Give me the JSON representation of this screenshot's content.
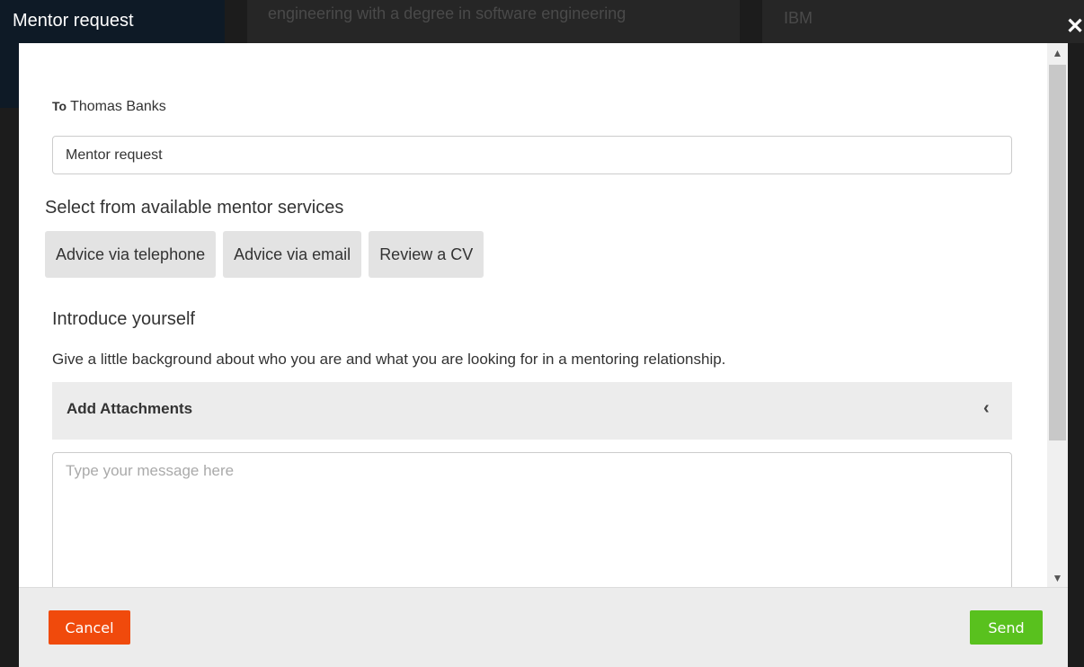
{
  "background": {
    "text_1": "engineering with a degree in software engineering",
    "text_2": "IBM"
  },
  "modal": {
    "title": "Mentor request",
    "close_glyph": "✕",
    "to_label": "To",
    "to_name": "Thomas Banks",
    "subject_value": "Mentor request",
    "services_heading": "Select from available mentor services",
    "services": [
      {
        "label": "Advice via telephone"
      },
      {
        "label": "Advice via email"
      },
      {
        "label": "Review a CV"
      }
    ],
    "intro_heading": "Introduce yourself",
    "intro_help": "Give a little background about who you are and what you are looking for in a mentoring relationship.",
    "attachments_label": "Add Attachments",
    "attachments_icon": "chevron-left-icon",
    "message_placeholder": "Type your message here",
    "cancel_label": "Cancel",
    "send_label": "Send"
  },
  "colors": {
    "cancel": "#f04a0c",
    "send": "#59c11e",
    "service_button": "#e3e3e3",
    "footer": "#ececec"
  }
}
